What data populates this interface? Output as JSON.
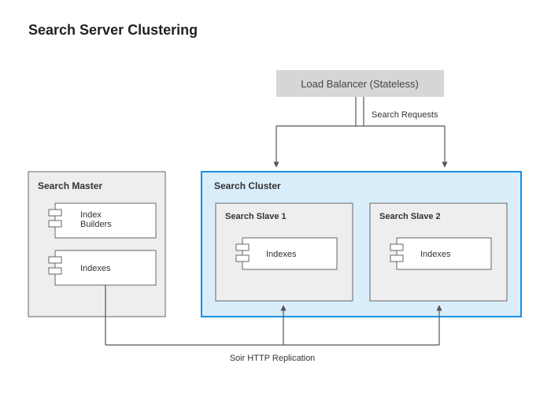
{
  "title": "Search Server Clustering",
  "load_balancer": {
    "label": "Load Balancer (Stateless)"
  },
  "edges": {
    "requests": "Search Requests",
    "replication": "Soir HTTP Replication"
  },
  "master": {
    "title": "Search Master",
    "components": {
      "builders": "Index\nBuilders",
      "indexes": "Indexes"
    }
  },
  "cluster": {
    "title": "Search Cluster",
    "slaves": [
      {
        "title": "Search Slave 1",
        "component": "Indexes"
      },
      {
        "title": "Search Slave 2",
        "component": "Indexes"
      }
    ]
  }
}
